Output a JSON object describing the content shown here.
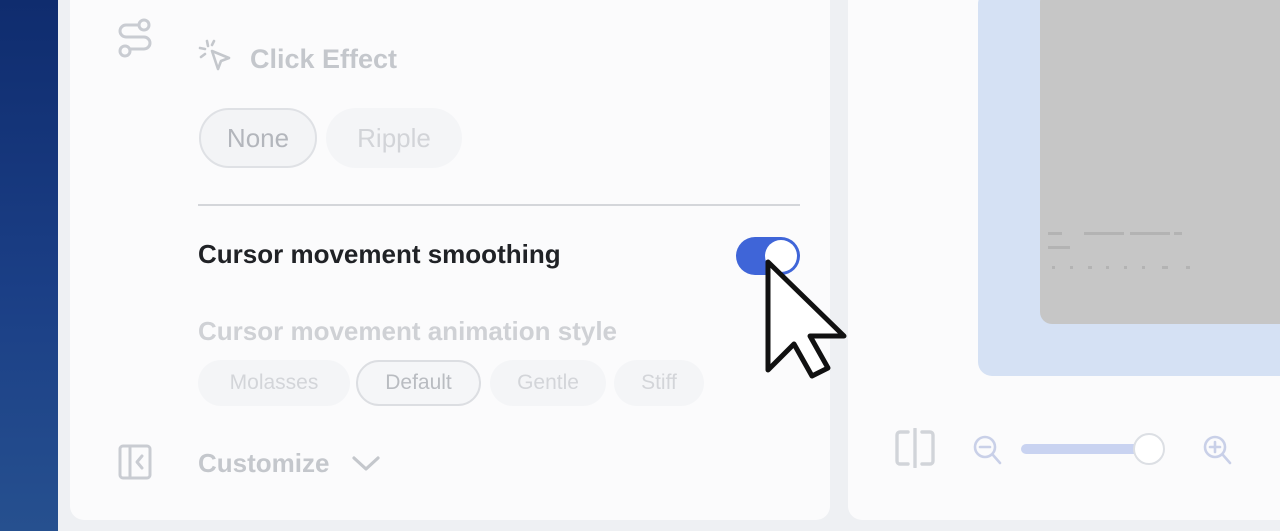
{
  "click_effect": {
    "title": "Click Effect",
    "icon": "click-sparkle-icon",
    "options": [
      {
        "label": "None",
        "selected": true
      },
      {
        "label": "Ripple",
        "selected": false
      }
    ]
  },
  "smoothing": {
    "label": "Cursor movement smoothing",
    "enabled": true,
    "accent": "#3f65d8"
  },
  "animation_style": {
    "label": "Cursor movement animation style",
    "options": [
      {
        "label": "Molasses",
        "selected": false
      },
      {
        "label": "Default",
        "selected": true
      },
      {
        "label": "Gentle",
        "selected": false
      },
      {
        "label": "Stiff",
        "selected": false
      }
    ]
  },
  "customize": {
    "label": "Customize",
    "icon": "chevron-down-icon"
  },
  "sidebar": {
    "icons": [
      "path-route-icon",
      "collapse-panel-icon"
    ]
  },
  "preview": {
    "zoom_level": 0.93,
    "icons": [
      "split-view-icon",
      "zoom-out-icon",
      "zoom-in-icon"
    ]
  }
}
